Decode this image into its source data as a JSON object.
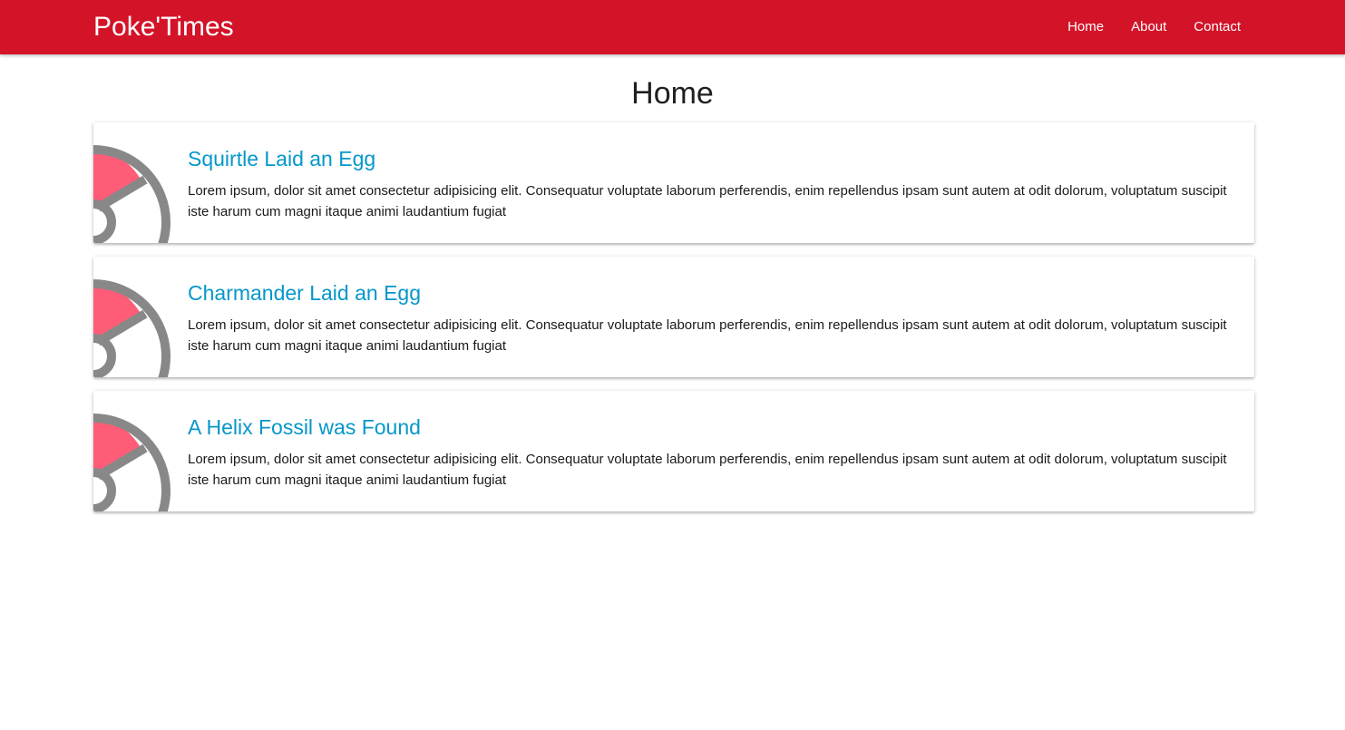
{
  "navbar": {
    "brand": "Poke'Times",
    "background_color": "#d31328",
    "links": [
      {
        "label": "Home"
      },
      {
        "label": "About"
      },
      {
        "label": "Contact"
      }
    ]
  },
  "page": {
    "title": "Home"
  },
  "posts": [
    {
      "title": "Squirtle Laid an Egg",
      "body": "Lorem ipsum, dolor sit amet consectetur adipisicing elit. Consequatur voluptate laborum perferendis, enim repellendus ipsam sunt autem at odit dolorum, voluptatum suscipit iste harum cum magni itaque animi laudantium fugiat",
      "icon": "pokeball-icon"
    },
    {
      "title": "Charmander Laid an Egg",
      "body": "Lorem ipsum, dolor sit amet consectetur adipisicing elit. Consequatur voluptate laborum perferendis, enim repellendus ipsam sunt autem at odit dolorum, voluptatum suscipit iste harum cum magni itaque animi laudantium fugiat",
      "icon": "pokeball-icon"
    },
    {
      "title": "A Helix Fossil was Found",
      "body": "Lorem ipsum, dolor sit amet consectetur adipisicing elit. Consequatur voluptate laborum perferendis, enim repellendus ipsam sunt autem at odit dolorum, voluptatum suscipit iste harum cum magni itaque animi laudantium fugiat",
      "icon": "pokeball-icon"
    }
  ],
  "colors": {
    "accent": "#d31328",
    "post_title": "#0597c9",
    "pokeball_red": "#ff5c77",
    "pokeball_gray": "#888888"
  }
}
